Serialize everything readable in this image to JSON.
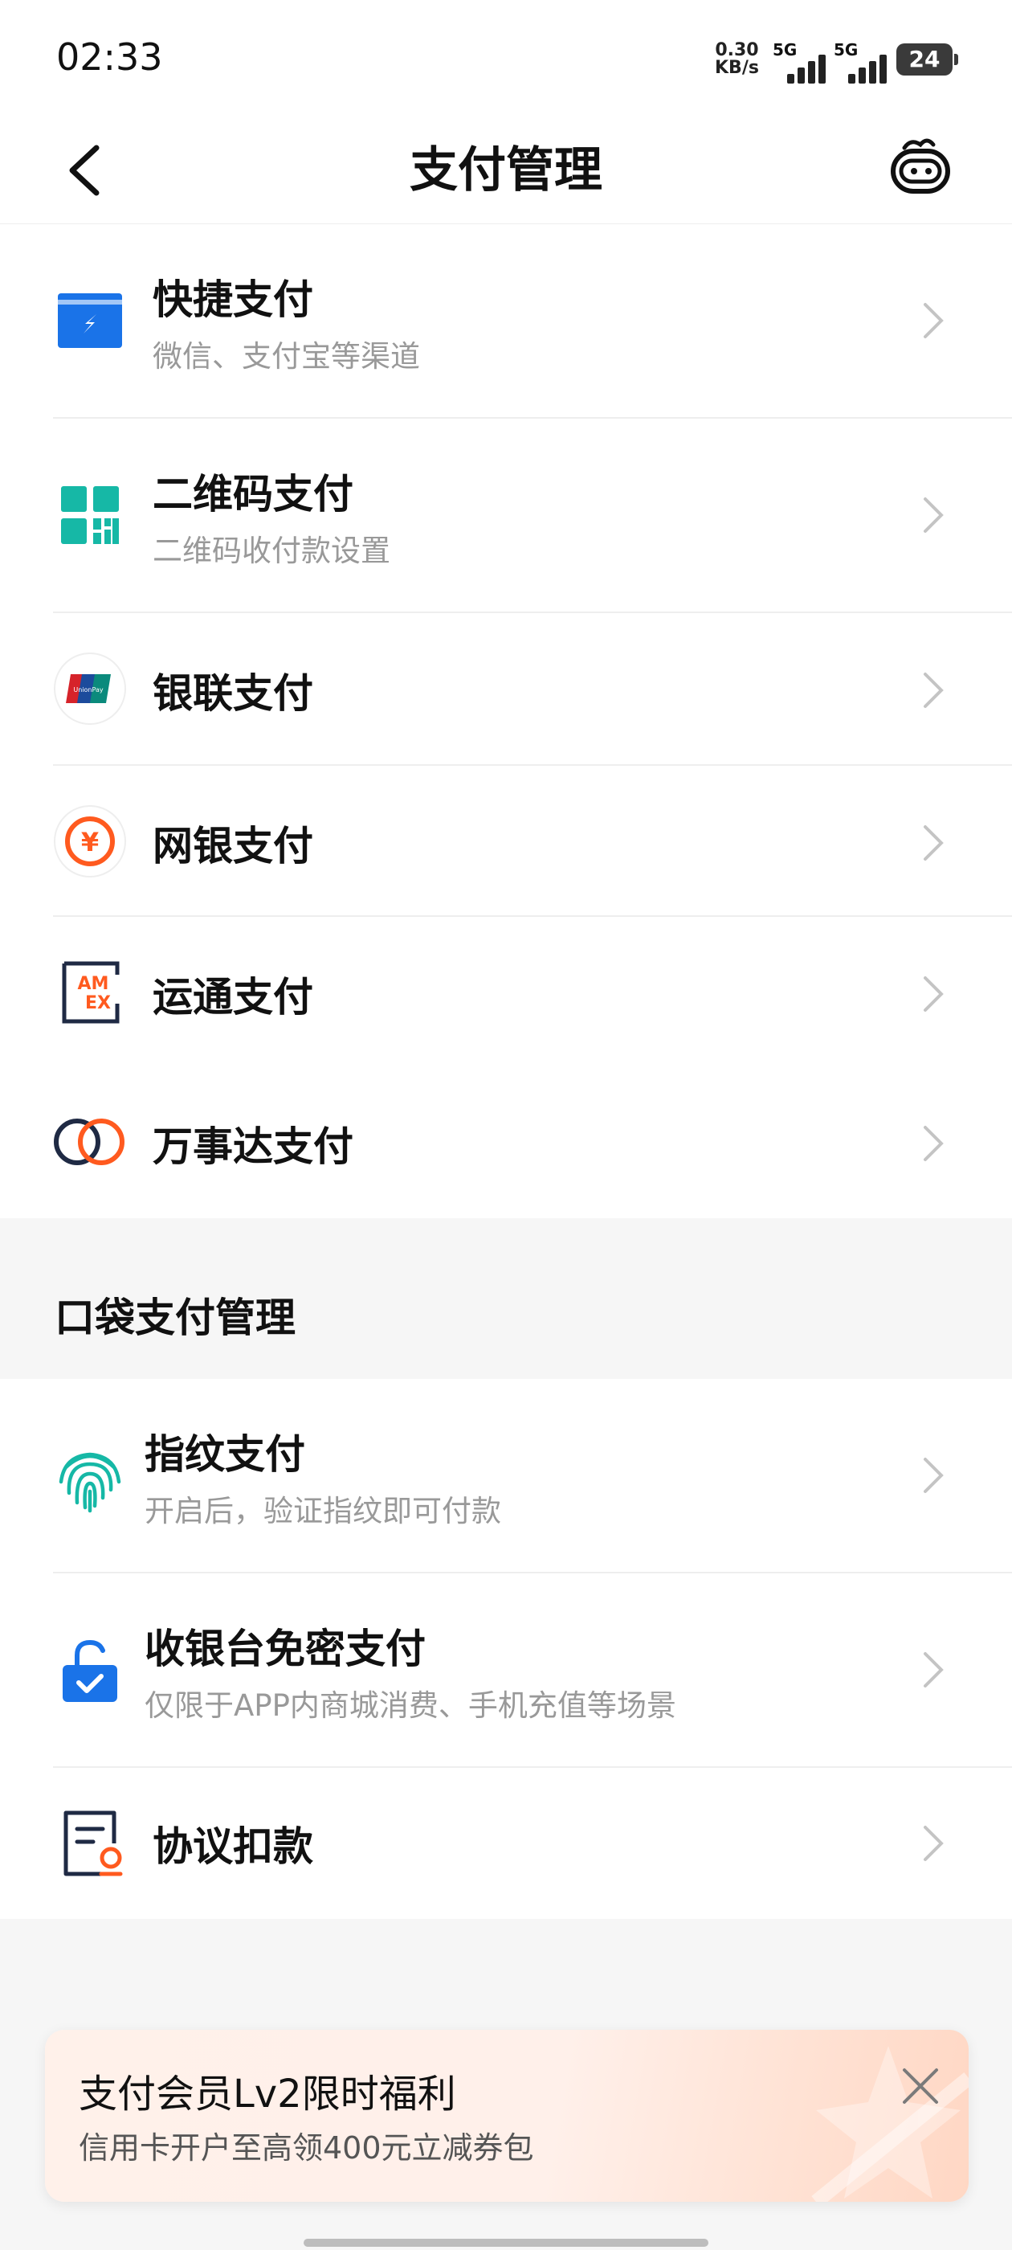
{
  "status_bar": {
    "time": "02:33",
    "speed_value": "0.30",
    "speed_unit": "KB/s",
    "net1": "5G",
    "net2": "5G",
    "battery": "24"
  },
  "header": {
    "title": "支付管理"
  },
  "payment_methods": [
    {
      "title": "快捷支付",
      "subtitle": "微信、支付宝等渠道",
      "icon": "quick-pay-icon"
    },
    {
      "title": "二维码支付",
      "subtitle": "二维码收付款设置",
      "icon": "qr-code-icon"
    },
    {
      "title": "银联支付",
      "subtitle": "",
      "icon": "unionpay-icon"
    },
    {
      "title": "网银支付",
      "subtitle": "",
      "icon": "yuan-icon"
    },
    {
      "title": "运通支付",
      "subtitle": "",
      "icon": "amex-icon"
    },
    {
      "title": "万事达支付",
      "subtitle": "",
      "icon": "mastercard-icon"
    }
  ],
  "pocket_section": {
    "heading": "口袋支付管理"
  },
  "pocket_items": [
    {
      "title": "指纹支付",
      "subtitle": "开启后，验证指纹即可付款",
      "icon": "fingerprint-icon"
    },
    {
      "title": "收银台免密支付",
      "subtitle": "仅限于APP内商城消费、手机充值等场景",
      "icon": "unlock-icon"
    },
    {
      "title": "协议扣款",
      "subtitle": "",
      "icon": "agreement-icon"
    }
  ],
  "icon_labels": {
    "amex_top": "AM",
    "amex_bottom": "EX",
    "unionpay": "UnionPay",
    "yuan": "¥"
  },
  "banner": {
    "title": "支付会员Lv2限时福利",
    "subtitle": "信用卡开户至高领400元立减券包"
  },
  "colors": {
    "blue": "#1a73e8",
    "teal": "#16b8a6",
    "orange": "#ff5a1f",
    "navy": "#1f2a44"
  }
}
